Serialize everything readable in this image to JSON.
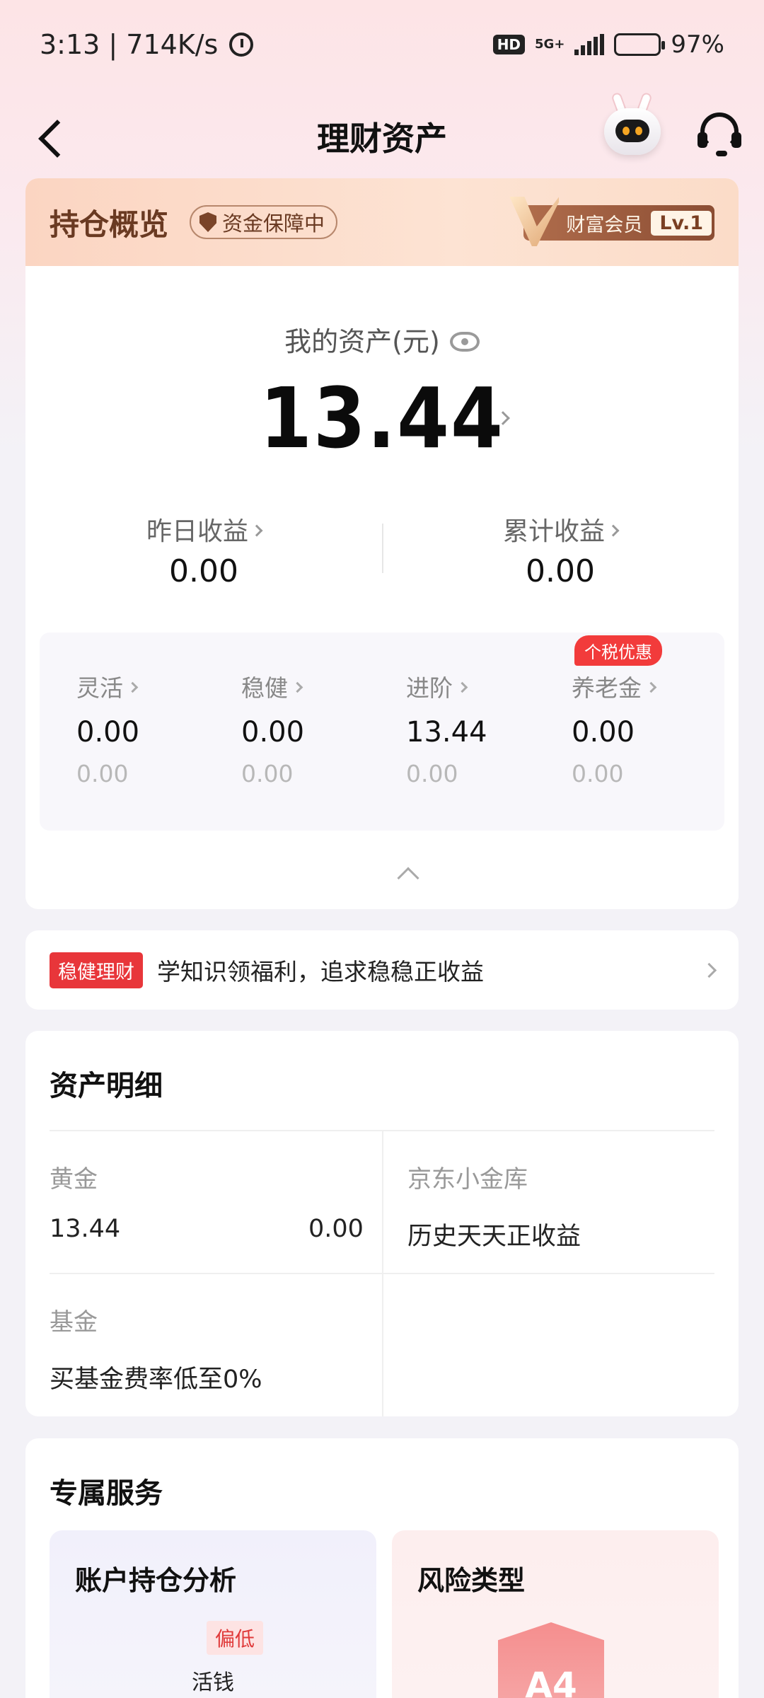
{
  "status_bar": {
    "time_speed": "3:13 | 714K/s",
    "hd": "HD",
    "network": "5G+",
    "battery": "97%"
  },
  "header": {
    "title": "理财资产"
  },
  "overview": {
    "title": "持仓概览",
    "safe_badge": "资金保障中",
    "member_label": "财富会员",
    "member_level": "Lv.1",
    "asset_label": "我的资产(元)",
    "asset_value": "13.44",
    "yesterday_label": "昨日收益",
    "yesterday_value": "0.00",
    "total_label": "累计收益",
    "total_value": "0.00",
    "categories": [
      {
        "label": "灵活",
        "value": "0.00",
        "sub": "0.00"
      },
      {
        "label": "稳健",
        "value": "0.00",
        "sub": "0.00"
      },
      {
        "label": "进阶",
        "value": "13.44",
        "sub": "0.00"
      },
      {
        "label": "养老金",
        "value": "0.00",
        "sub": "0.00",
        "tag": "个税优惠"
      }
    ]
  },
  "banner": {
    "tag": "稳健理财",
    "text": "学知识领福利，追求稳稳正收益"
  },
  "detail": {
    "title": "资产明细",
    "gold_label": "黄金",
    "gold_value": "13.44",
    "gold_profit": "0.00",
    "jd_label": "京东小金库",
    "jd_text": "历史天天正收益",
    "fund_label": "基金",
    "fund_text": "买基金费率低至0%"
  },
  "service": {
    "title": "专属服务",
    "analysis_title": "账户持仓分析",
    "analysis_tag": "偏低",
    "analysis_sub": "活钱",
    "risk_title": "风险类型",
    "risk_level": "A4"
  },
  "colors": {
    "accent_red": "#e8363a",
    "overview_header": "#fbd5c2",
    "page_bg": "#f3f2f7"
  }
}
